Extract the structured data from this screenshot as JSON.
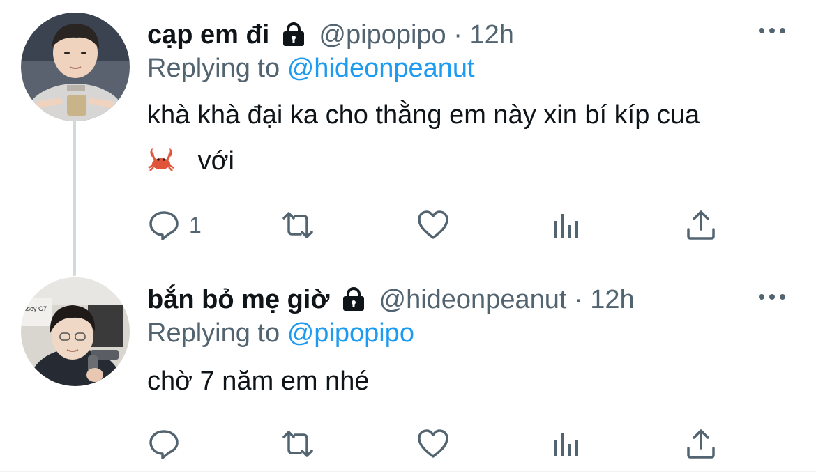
{
  "tweets": [
    {
      "name": "cạp em đi",
      "handle": "@pipopipo",
      "separator": "·",
      "time": "12h",
      "replying_prefix": "Replying to",
      "replying_to": "@hideonpeanut",
      "text_line1": "khà khà đại ka cho thằng em này xin bí kíp cua",
      "text_line2_emoji": "🦀",
      "text_line2": "với",
      "reply_count": "1",
      "more_icon": "more-horizontal-icon"
    },
    {
      "name": "bắn bỏ mẹ giờ",
      "handle": "@hideonpeanut",
      "separator": "·",
      "time": "12h",
      "replying_prefix": "Replying to",
      "replying_to": "@pipopipo",
      "text_line1": "chờ 7 năm em nhé",
      "reply_count": "",
      "more_icon": "more-horizontal-icon",
      "avatar_poster_text": "ssey G7"
    }
  ],
  "colors": {
    "text": "#0f1419",
    "secondary": "#536471",
    "accent": "#1d9bf0",
    "thread_line": "#cfd9de"
  }
}
